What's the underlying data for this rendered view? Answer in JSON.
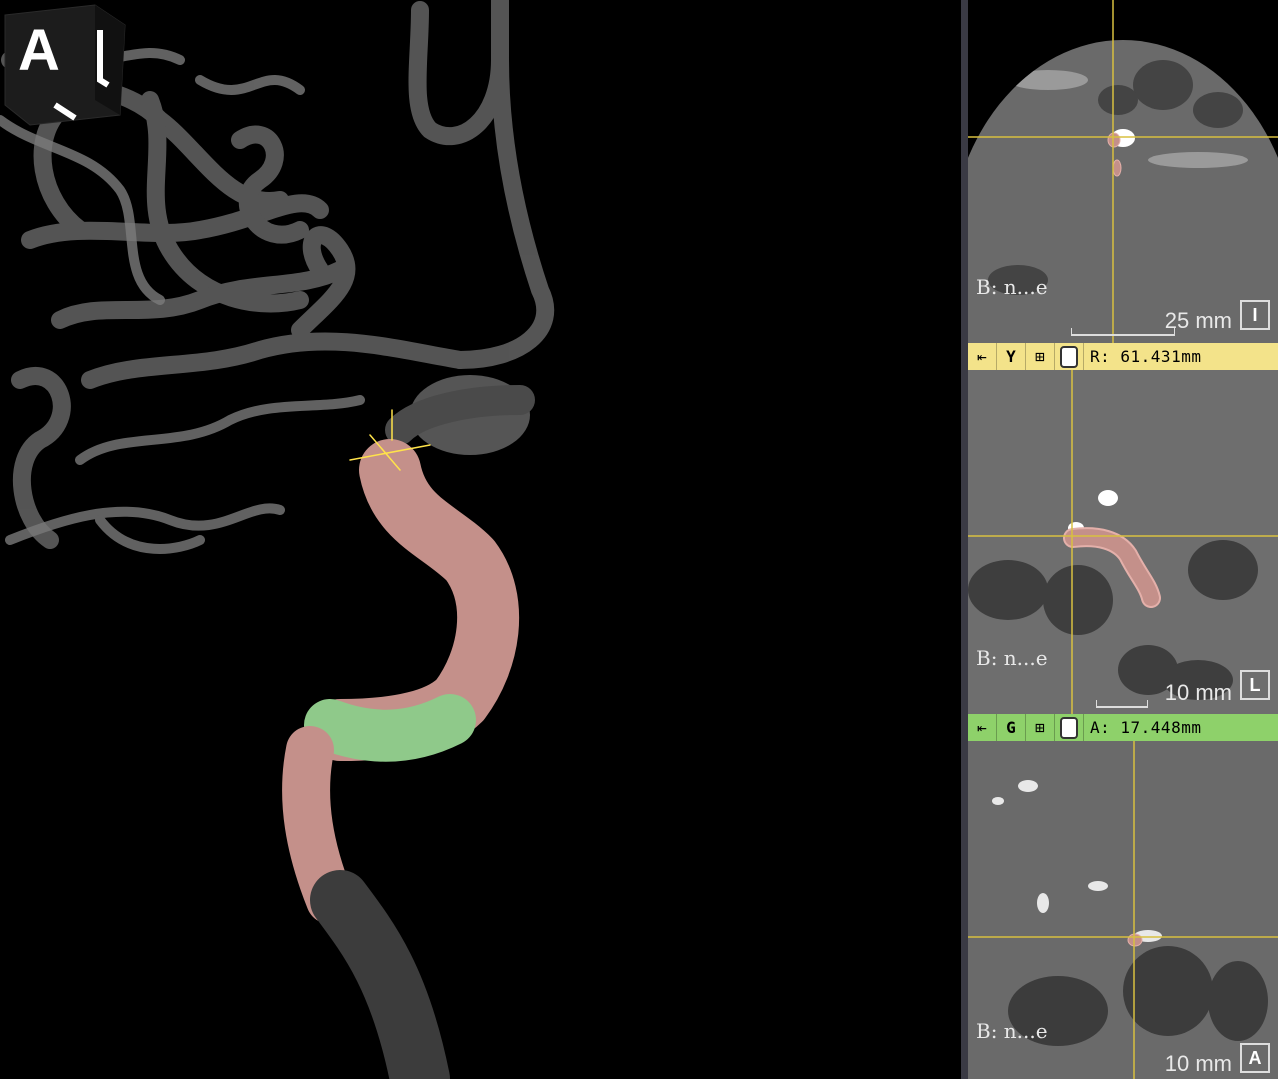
{
  "viewer_3d": {
    "orientation_cube_label": "A",
    "colors": {
      "vessel_gray": "#6f6f6f",
      "segment_pink": "#c4908a",
      "segment_green": "#8fc98a",
      "dark_vessel": "#3c3c3c"
    }
  },
  "slices": [
    {
      "id": "axial",
      "label": "B: n...e",
      "scale": "25 mm",
      "orientation": "I"
    },
    {
      "id": "sagittal",
      "label": "B: n...e",
      "scale": "10 mm",
      "orientation": "L"
    },
    {
      "id": "coronal",
      "label": "B: n...e",
      "scale": "10 mm",
      "orientation": "A"
    }
  ],
  "toolbars": {
    "yellow": {
      "letter": "Y",
      "value": "R: 61.431mm",
      "color": "#f3e38a"
    },
    "green": {
      "letter": "G",
      "value": "A: 17.448mm",
      "color": "#8ed16a"
    }
  },
  "icons": {
    "pin": "pin-icon",
    "grid": "layout-grid-icon",
    "slider": "slider-knob"
  }
}
